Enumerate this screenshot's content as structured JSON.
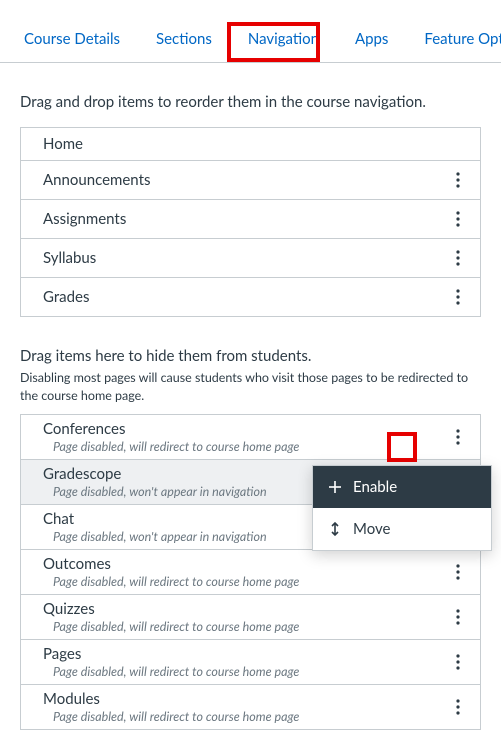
{
  "tabs": {
    "course_details": "Course Details",
    "sections": "Sections",
    "navigation": "Navigation",
    "apps": "Apps",
    "feature_options": "Feature Options"
  },
  "enabled": {
    "description": "Drag and drop items to reorder them in the course navigation.",
    "items": [
      {
        "label": "Home"
      },
      {
        "label": "Announcements"
      },
      {
        "label": "Assignments"
      },
      {
        "label": "Syllabus"
      },
      {
        "label": "Grades"
      }
    ]
  },
  "hidden": {
    "description": "Drag items here to hide them from students.",
    "sub_description": "Disabling most pages will cause students who visit those pages to be redirected to the course home page.",
    "items": [
      {
        "label": "Conferences",
        "sub": "Page disabled, will redirect to course home page"
      },
      {
        "label": "Gradescope",
        "sub": "Page disabled, won't appear in navigation"
      },
      {
        "label": "Chat",
        "sub": "Page disabled, won't appear in navigation"
      },
      {
        "label": "Outcomes",
        "sub": "Page disabled, will redirect to course home page"
      },
      {
        "label": "Quizzes",
        "sub": "Page disabled, will redirect to course home page"
      },
      {
        "label": "Pages",
        "sub": "Page disabled, will redirect to course home page"
      },
      {
        "label": "Modules",
        "sub": "Page disabled, will redirect to course home page"
      }
    ]
  },
  "menu": {
    "enable": "Enable",
    "move": "Move"
  }
}
